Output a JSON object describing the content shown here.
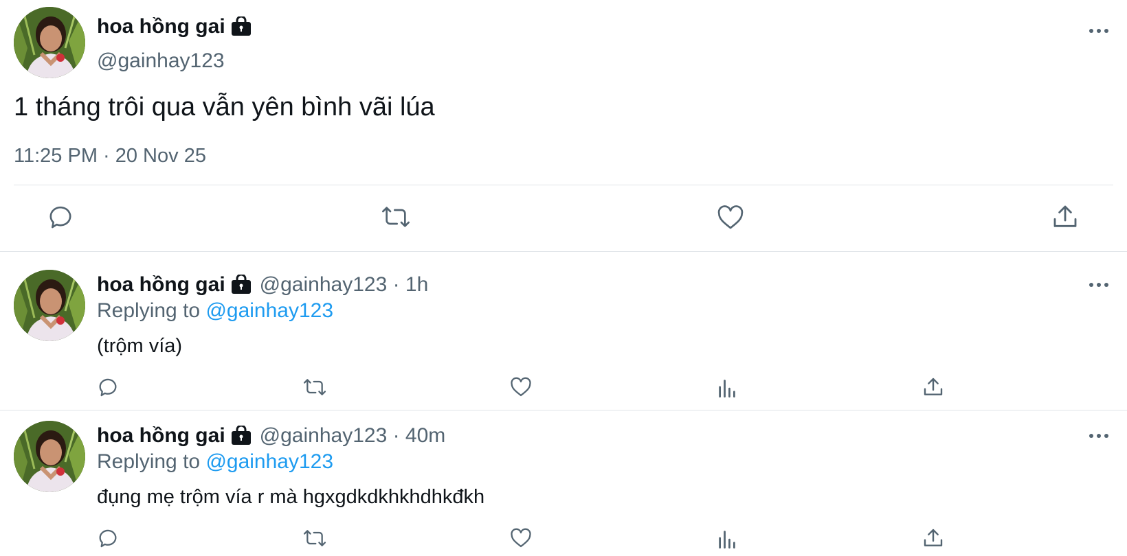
{
  "main_tweet": {
    "display_name": "hoa hồng gai",
    "handle": "@gainhay123",
    "text": "1 tháng trôi qua vẫn yên bình vãi lúa",
    "timestamp": "11:25 PM · 20 Nov 25",
    "actions": [
      "reply-icon",
      "retweet-icon",
      "like-icon",
      "share-icon"
    ]
  },
  "replies": [
    {
      "display_name": "hoa hồng gai",
      "meta": "@gainhay123 · 1h",
      "replying_prefix": "Replying to ",
      "replying_to": "@gainhay123",
      "text": "(trộm vía)"
    },
    {
      "display_name": "hoa hồng gai",
      "meta": "@gainhay123 · 40m",
      "replying_prefix": "Replying to ",
      "replying_to": "@gainhay123",
      "text": "đụng mẹ trộm vía r mà hgxgdkdkhkhdhkđkh"
    }
  ],
  "reply_actions": [
    "reply-icon",
    "retweet-icon",
    "like-icon",
    "analytics-icon",
    "share-icon"
  ],
  "colors": {
    "text": "#0f1419",
    "secondary": "#536471",
    "link": "#1d9bf0",
    "divider": "#dfe3e7"
  }
}
